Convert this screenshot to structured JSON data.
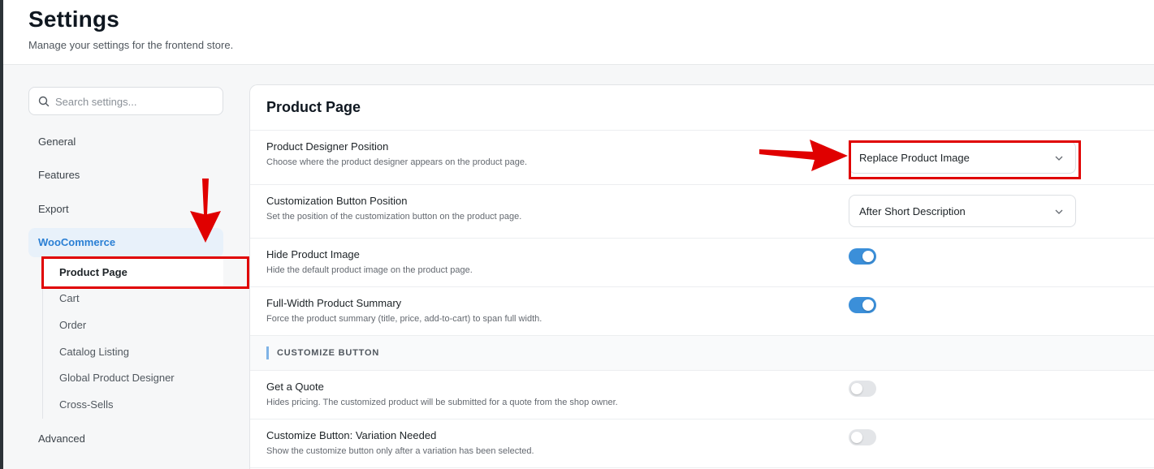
{
  "header": {
    "title": "Settings",
    "subtitle": "Manage your settings for the frontend store."
  },
  "sidebar": {
    "search_placeholder": "Search settings...",
    "items": [
      {
        "label": "General"
      },
      {
        "label": "Features"
      },
      {
        "label": "Export"
      },
      {
        "label": "WooCommerce",
        "active": true
      },
      {
        "label": "Advanced"
      }
    ],
    "woocommerce_sub": [
      {
        "label": "Product Page",
        "active": true
      },
      {
        "label": "Cart"
      },
      {
        "label": "Order"
      },
      {
        "label": "Catalog Listing"
      },
      {
        "label": "Global Product Designer"
      },
      {
        "label": "Cross-Sells"
      }
    ]
  },
  "panel": {
    "title": "Product Page",
    "settings": [
      {
        "label": "Product Designer Position",
        "desc": "Choose where the product designer appears on the product page.",
        "control": "select",
        "value": "Replace Product Image"
      },
      {
        "label": "Customization Button Position",
        "desc": "Set the position of the customization button on the product page.",
        "control": "select",
        "value": "After Short Description"
      },
      {
        "label": "Hide Product Image",
        "desc": "Hide the default product image on the product page.",
        "control": "toggle",
        "enabled": true
      },
      {
        "label": "Full-Width Product Summary",
        "desc": "Force the product summary (title, price, add-to-cart) to span full width.",
        "control": "toggle",
        "enabled": true
      }
    ],
    "section_heading": "CUSTOMIZE BUTTON",
    "section_settings": [
      {
        "label": "Get a Quote",
        "desc": "Hides pricing. The customized product will be submitted for a quote from the shop owner.",
        "control": "toggle",
        "enabled": false
      },
      {
        "label": "Customize Button: Variation Needed",
        "desc": "Show the customize button only after a variation has been selected.",
        "control": "toggle",
        "enabled": false
      }
    ]
  },
  "colors": {
    "accent": "#2a7fd4",
    "toggle_on": "#3b8fd9",
    "annotation_red": "#e00000"
  }
}
